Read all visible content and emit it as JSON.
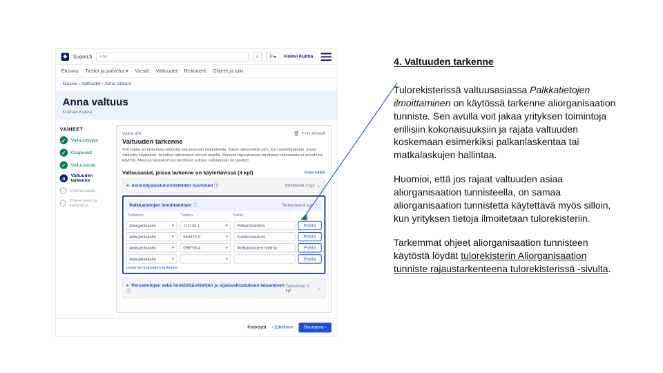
{
  "topbar": {
    "brand": "Suomi.fi",
    "search_placeholder": "Hae",
    "lang": "FI",
    "user_name": "Kalevi Kulma"
  },
  "nav": {
    "home": "Etusivu",
    "info": "Tiedot ja palvelut",
    "msgs": "Viestit",
    "auth": "Valtuudet",
    "reg": "Rekisterit",
    "guide": "Ohjeet ja tuki"
  },
  "breadcrumb": "Etusivu › Valtuudet › Anna valtuus",
  "page": {
    "title": "Anna valtuus",
    "sub": "Kulman Kukka"
  },
  "sidebar": {
    "heading": "VAIHEET",
    "s1": "Valtuustyyppi",
    "s2": "Osapuolet",
    "s3": "Valtuusasiat",
    "s4": "Valtuuden tarkenne",
    "s5": "Voimassaolo",
    "s6": "Yhteenveto ja vahvistus"
  },
  "content": {
    "step": "Vaihe 4/6",
    "delete": "TYHJENNÄ",
    "title": "Valtuuden tarkenne",
    "intro": "Voit rajata tai tarkentaa valtuutta valtuusasian tarkenteella. Käytä tarkennetta vain, kun asiointipalvelu, jossa valtuutta käytetään, ilmoittaa tarkenteen olevan tarjolla. Muussa tapauksessa tarvittava valtuusasia ei anneta tai käytetä. Muussa tapauksessa tarvittava valtuus valtuusasia on tarvitse.",
    "sub": "Valtuusasiat, joissa tarkenne on käytettävissä (4 kpl)",
    "open_all": "Avaa kaikki",
    "cat1": {
      "label": "Asiointipalvelutunnisteiden luominen",
      "meta": "Tarkenteet 0 kpl"
    },
    "exp": {
      "label": "Palkkatietojen ilmoittaminen",
      "meta": "Tarkenteet 4 kpl",
      "col1": "Tarkenne",
      "col2": "Tunnus",
      "col3": "Selite",
      "r1": {
        "a": "Aliorganisaatio",
        "b": "111234-1",
        "c": "Palkanlaskenta"
      },
      "r2": {
        "a": "Aliorganisaatio",
        "b": "654322-0",
        "c": "Kulukorvaukset"
      },
      "r3": {
        "a": "Aliorganisaatio",
        "b": "098765-4",
        "c": "Matkalaskujen hallinta"
      },
      "r4": {
        "a": "Aliorganisaatio",
        "b": "",
        "c": ""
      },
      "remove": "Poista",
      "hint": "Lisää rivi valtuuden tarkenne"
    },
    "cat2": {
      "label": "Perustietojen sekä henkilökäsittelijän ja sijaisvaltuutuksen lataaminen",
      "meta": "Tarkenteet 0 kpl"
    },
    "footer": {
      "cancel": "Keskeytä",
      "back": "Edellinen",
      "next": "Seuraava"
    }
  },
  "side": {
    "title": "4. Valtuuden tarkenne",
    "p1a": "Tulorekisterissä valtuusasiassa ",
    "p1_i": "Palkkatietojen ilmoittaminen",
    "p1b": " on käytössä tarkenne aliorganisaation tunniste. Sen avulla voit jakaa yrityksen toimintoja erillisiin kokonaisuuksiin ja rajata valtuuden koskemaan esimerkiksi palkanlaskentaa tai matkalaskujen hallintaa.",
    "p2": "Huomioi, että jos rajaat valtuuden asiaa aliorganisaation tunnisteella, on samaa aliorganisaation tunnistetta käytettävä myös silloin, kun yrityksen tietoja ilmoitetaan tulorekisteriin.",
    "p3a": "Tarkemmat ohjeet aliorganisaation tunnisteen käytöstä löydät ",
    "p3_link": "tulorekisterin Aliorganisaation tunniste rajaustarkenteena tulorekisterissä -sivulta",
    "p3b": "."
  }
}
